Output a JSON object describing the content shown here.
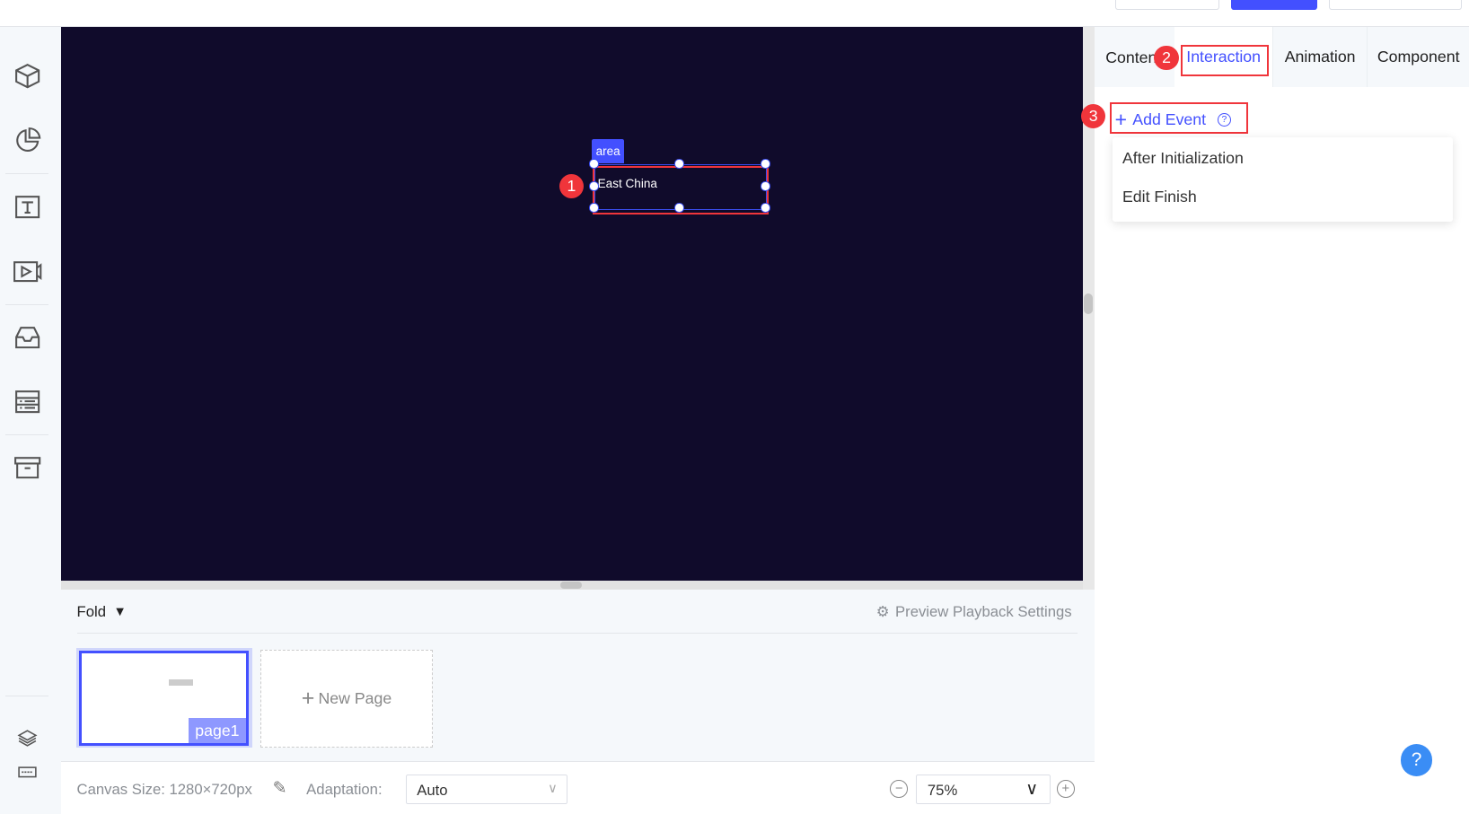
{
  "topbar": {
    "accent": "#4350ff"
  },
  "canvas": {
    "background": "#100b2b",
    "element_tag": "area",
    "element_text": "East China"
  },
  "annotations": {
    "badge1": "1",
    "badge2": "2",
    "badge3": "3"
  },
  "sidebar": {
    "items": [
      "cube-icon",
      "pie-chart-icon",
      "text-icon",
      "video-icon",
      "inbox-icon",
      "list-icon",
      "archive-icon",
      "layers-icon",
      "keyboard-icon"
    ]
  },
  "bottom": {
    "fold_label": "Fold",
    "preview_settings": "Preview Playback Settings",
    "pages": [
      {
        "label": "page1",
        "selected": true
      }
    ],
    "new_page": "New Page"
  },
  "footer": {
    "canvas_size": "Canvas Size: 1280×720px",
    "adaptation_label": "Adaptation:",
    "adaptation_value": "Auto",
    "zoom_value": "75%"
  },
  "panel": {
    "tabs": [
      {
        "label": "Content"
      },
      {
        "label": "Interaction",
        "active": true
      },
      {
        "label": "Animation"
      },
      {
        "label": "Component"
      }
    ],
    "add_event": "Add Event",
    "dropdown": [
      "After Initialization",
      "Edit Finish"
    ],
    "help": "?"
  }
}
